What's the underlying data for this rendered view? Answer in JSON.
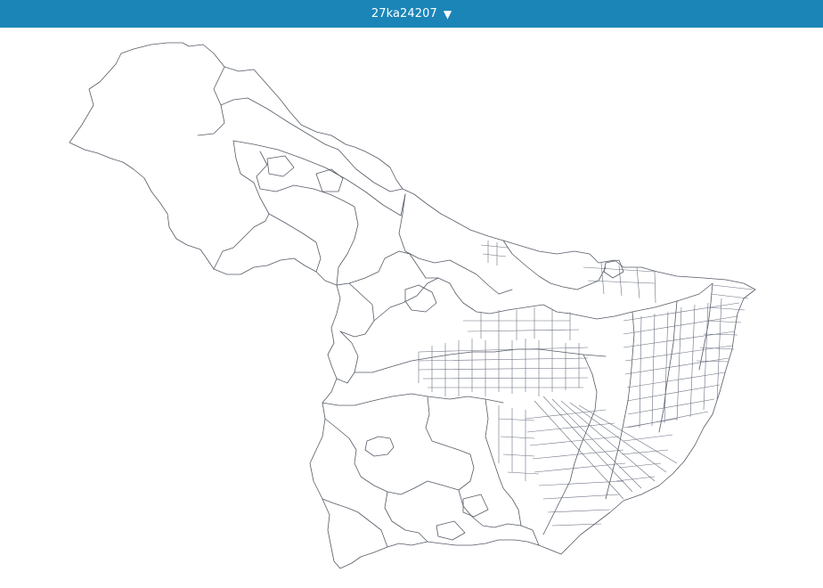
{
  "header": {
    "title": "27ka24207",
    "dropdown_icon": "triangle-down-icon"
  },
  "colors": {
    "header_bg": "#1b85b8",
    "header_text": "#ffffff",
    "boundary_stroke": "#555b66",
    "background": "#ffffff"
  }
}
